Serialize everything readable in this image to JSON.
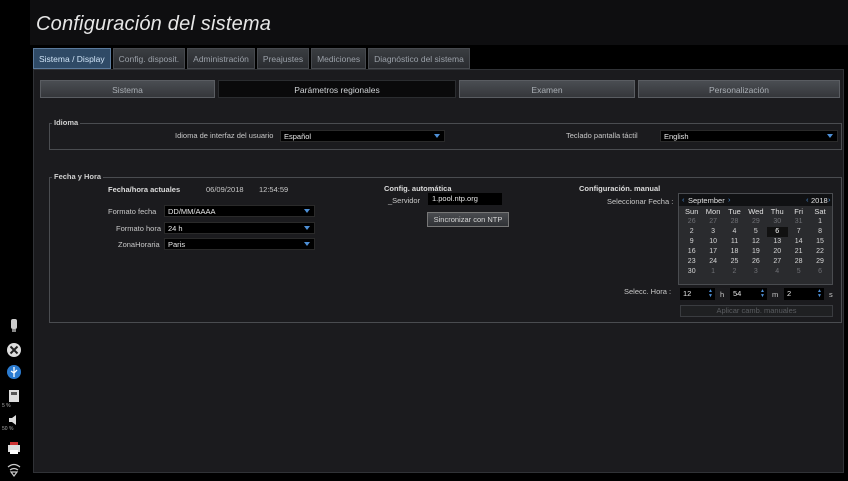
{
  "app": {
    "title": "Configuración del sistema"
  },
  "tabs": [
    {
      "label": "Sistema / Display",
      "active": true
    },
    {
      "label": "Config. disposit.",
      "active": false
    },
    {
      "label": "Administración",
      "active": false
    },
    {
      "label": "Preajustes",
      "active": false
    },
    {
      "label": "Mediciones",
      "active": false
    },
    {
      "label": "Diagnóstico del sistema",
      "active": false
    }
  ],
  "subtabs": [
    {
      "label": "Sistema",
      "active": false
    },
    {
      "label": "Parámetros regionales",
      "active": true
    },
    {
      "label": "Examen",
      "active": false
    },
    {
      "label": "Personalización",
      "active": false
    }
  ],
  "idioma": {
    "group_label": "Idioma",
    "ui_language_label": "Idioma de interfaz del usuario",
    "ui_language_value": "Español",
    "keyboard_label": "Teclado pantalla táctil",
    "keyboard_value": "English"
  },
  "fecha_hora": {
    "group_label": "Fecha y Hora",
    "current_label": "Fecha/hora actuales",
    "current_date": "06/09/2018",
    "current_time": "12:54:59",
    "date_format_label": "Formato fecha",
    "date_format_value": "DD/MM/AAAA",
    "time_format_label": "Formato hora",
    "time_format_value": "24 h",
    "timezone_label": "ZonaHoraria",
    "timezone_value": "Paris",
    "auto": {
      "title": "Config. automática",
      "server_label": "_Servidor",
      "server_value": "1.pool.ntp.org",
      "sync_button": "Sincronizar con NTP"
    },
    "manual": {
      "title": "Configuración. manual",
      "select_date_label": "Seleccionar Fecha :",
      "month": "September",
      "year": "2018",
      "weekdays": [
        "Sun",
        "Mon",
        "Tue",
        "Wed",
        "Thu",
        "Fri",
        "Sat"
      ],
      "weeks": [
        [
          {
            "d": "26",
            "o": true
          },
          {
            "d": "27",
            "o": true
          },
          {
            "d": "28",
            "o": true
          },
          {
            "d": "29",
            "o": true
          },
          {
            "d": "30",
            "o": true
          },
          {
            "d": "31",
            "o": true
          },
          {
            "d": "1"
          }
        ],
        [
          {
            "d": "2"
          },
          {
            "d": "3"
          },
          {
            "d": "4"
          },
          {
            "d": "5"
          },
          {
            "d": "6",
            "sel": true
          },
          {
            "d": "7"
          },
          {
            "d": "8"
          }
        ],
        [
          {
            "d": "9"
          },
          {
            "d": "10"
          },
          {
            "d": "11"
          },
          {
            "d": "12"
          },
          {
            "d": "13"
          },
          {
            "d": "14"
          },
          {
            "d": "15"
          }
        ],
        [
          {
            "d": "16"
          },
          {
            "d": "17"
          },
          {
            "d": "18"
          },
          {
            "d": "19"
          },
          {
            "d": "20"
          },
          {
            "d": "21"
          },
          {
            "d": "22"
          }
        ],
        [
          {
            "d": "23"
          },
          {
            "d": "24"
          },
          {
            "d": "25"
          },
          {
            "d": "26"
          },
          {
            "d": "27"
          },
          {
            "d": "28"
          },
          {
            "d": "29"
          }
        ],
        [
          {
            "d": "30"
          },
          {
            "d": "1",
            "o": true
          },
          {
            "d": "2",
            "o": true
          },
          {
            "d": "3",
            "o": true
          },
          {
            "d": "4",
            "o": true
          },
          {
            "d": "5",
            "o": true
          },
          {
            "d": "6",
            "o": true
          }
        ]
      ],
      "select_time_label": "Selecc. Hora :",
      "hours": "12",
      "hours_unit": "h",
      "minutes": "54",
      "minutes_unit": "m",
      "seconds": "2",
      "seconds_unit": "s",
      "apply_button": "Aplicar camb. manuales"
    }
  },
  "leftbar": {
    "probe_label": "",
    "storage_pct": "5 %",
    "volume_pct": "50 %"
  },
  "colors": {
    "accent": "#4d8fd6",
    "tab_active": "#2f4a66"
  }
}
